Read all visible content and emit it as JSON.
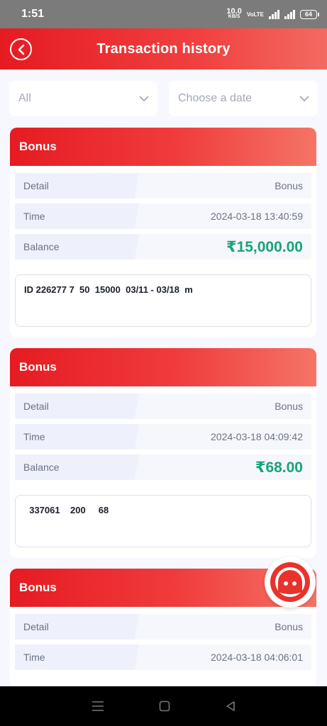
{
  "status_bar": {
    "time": "1:51",
    "speed_value": "10.0",
    "speed_unit": "KB/S",
    "network_label": "VoLTE",
    "battery": "64"
  },
  "header": {
    "title": "Transaction history"
  },
  "filters": {
    "type_value": "All",
    "date_placeholder": "Choose a date"
  },
  "labels": {
    "detail": "Detail",
    "time": "Time",
    "balance": "Balance"
  },
  "transactions": [
    {
      "type": "Bonus",
      "detail": "Bonus",
      "time": "2024-03-18 13:40:59",
      "balance": "₹15,000.00",
      "note": "ID 226277 7  50  15000  03/11 - 03/18  m"
    },
    {
      "type": "Bonus",
      "detail": "Bonus",
      "time": "2024-03-18 04:09:42",
      "balance": "₹68.00",
      "note": "  337061    200     68"
    },
    {
      "type": "Bonus",
      "detail": "Bonus",
      "time": "2024-03-18 04:06:01",
      "balance": "",
      "note": ""
    }
  ],
  "colors": {
    "brand_red": "#e51b22",
    "money_green": "#17a37d"
  }
}
